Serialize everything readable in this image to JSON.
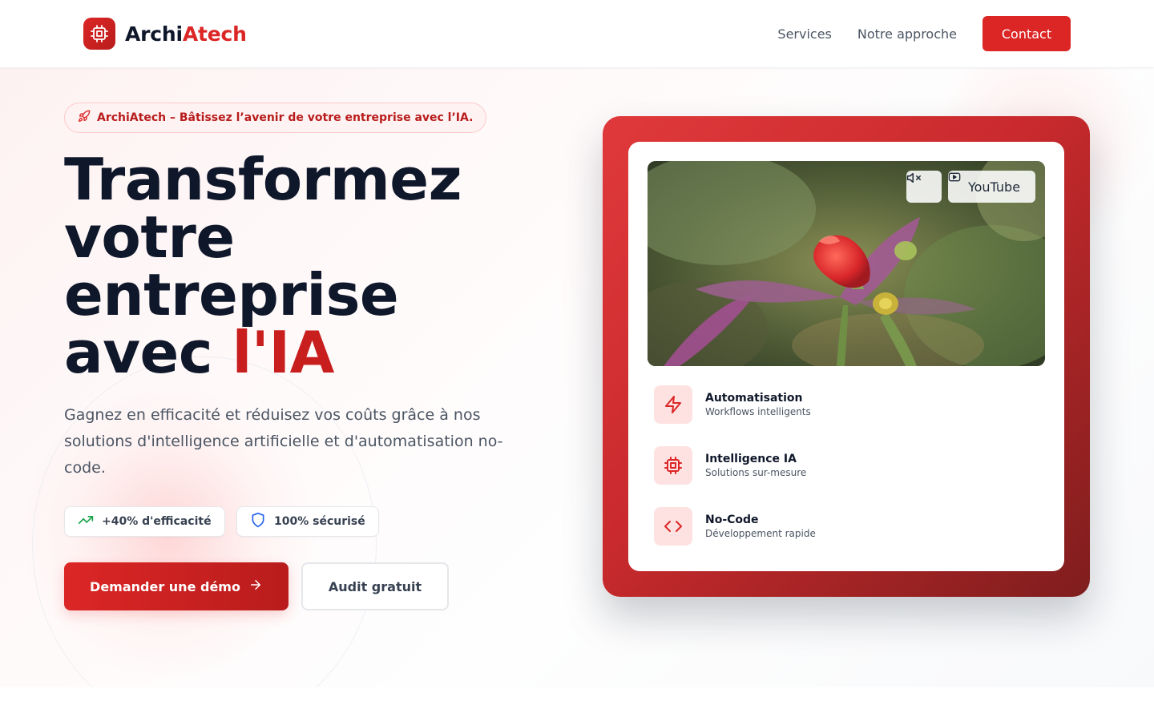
{
  "header": {
    "logo_part1": "Archi",
    "logo_part2": "Atech",
    "nav": [
      "Services",
      "Notre approche"
    ],
    "contact_label": "Contact"
  },
  "hero": {
    "badge": "ArchiAtech – Bâtissez l’avenir de votre entreprise avec l’IA.",
    "headline_lines": [
      "Transformez",
      "votre",
      "entreprise"
    ],
    "headline_last_prefix": "avec ",
    "headline_accent": "l'IA",
    "subtitle": "Gagnez en efficacité et réduisez vos coûts grâce à nos solutions d'intelligence artificielle et d'automatisation no-code.",
    "stats": [
      {
        "label": "+40% d'efficacité",
        "icon": "trending-up-icon"
      },
      {
        "label": "100% sécurisé",
        "icon": "shield-icon"
      }
    ],
    "cta_primary": "Demander une démo",
    "cta_secondary": "Audit gratuit"
  },
  "card": {
    "video": {
      "youtube_label": "YouTube",
      "mute_icon": "volume-mute-icon"
    },
    "features": [
      {
        "title": "Automatisation",
        "subtitle": "Workflows intelligents",
        "icon": "lightning-icon"
      },
      {
        "title": "Intelligence IA",
        "subtitle": "Solutions sur-mesure",
        "icon": "cpu-chip-icon"
      },
      {
        "title": "No-Code",
        "subtitle": "Développement rapide",
        "icon": "code-brackets-icon"
      }
    ]
  },
  "colors": {
    "accent": "#dc2626",
    "accent_dark": "#b91c1c",
    "text_dark": "#0f172a",
    "text_muted": "#4b5563",
    "stat_green": "#16a34a",
    "stat_blue": "#2563eb"
  }
}
